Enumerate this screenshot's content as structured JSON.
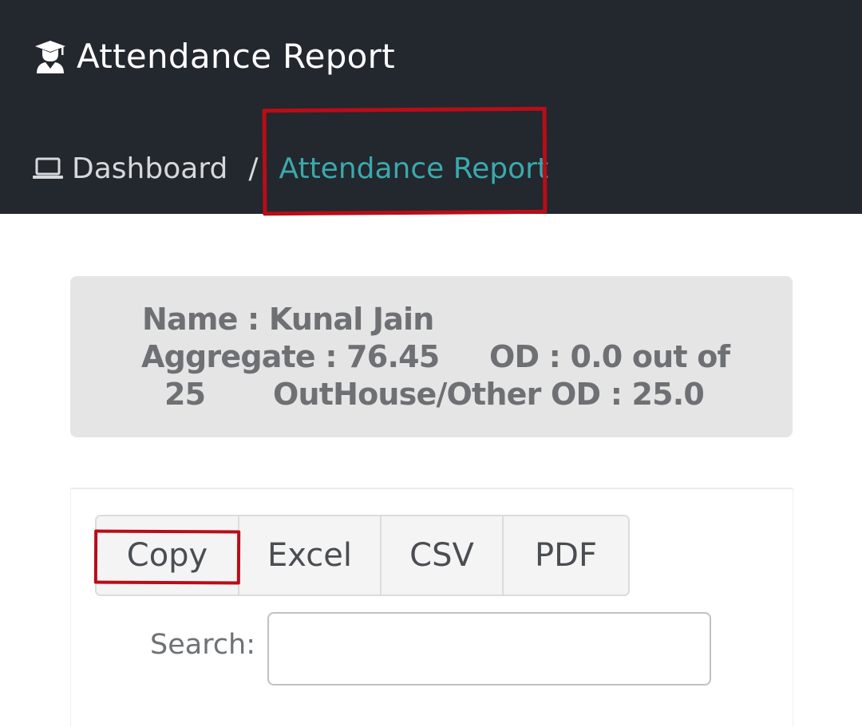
{
  "header": {
    "title": "Attendance Report",
    "title_icon": "graduate-icon"
  },
  "breadcrumb": {
    "home_icon": "laptop-icon",
    "home": "Dashboard",
    "separator": "/",
    "current": "Attendance Report"
  },
  "student": {
    "name_line": "Name : Kunal Jain",
    "aggregate": "Aggregate : 76.45",
    "od_prefix": "OD : 0.0 out of",
    "od_total": "25",
    "outhouse_od": "OutHouse/Other OD : 25.0"
  },
  "export_buttons": {
    "copy": "Copy",
    "excel": "Excel",
    "csv": "CSV",
    "pdf": "PDF"
  },
  "search": {
    "label": "Search:",
    "value": ""
  },
  "colors": {
    "header_bg": "#23272e",
    "accent": "#3aa9ad",
    "annotation": "#b80d17",
    "panel_bg": "#e5e5e5"
  }
}
